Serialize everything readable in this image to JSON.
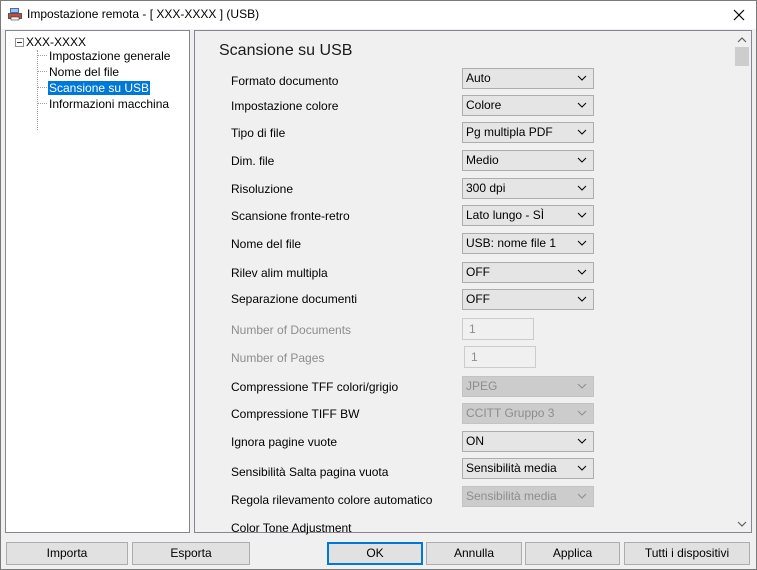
{
  "window": {
    "title": "Impostazione remota - [ XXX-XXXX  ] (USB)",
    "app_icon": "printer-app-icon",
    "close_icon": "close-icon"
  },
  "tree": {
    "root_label": "XXX-XXXX",
    "items": [
      {
        "label": "Impostazione generale",
        "selected": false
      },
      {
        "label": "Nome del file",
        "selected": false
      },
      {
        "label": "Scansione su USB",
        "selected": true
      },
      {
        "label": "Informazioni macchina",
        "selected": false
      }
    ]
  },
  "main": {
    "title": "Scansione su USB",
    "settings": [
      {
        "label": "Formato documento",
        "value": "Auto",
        "type": "combo",
        "disabled": false
      },
      {
        "label": "Impostazione colore",
        "value": "Colore",
        "type": "combo",
        "disabled": false
      },
      {
        "label": "Tipo di file",
        "value": "Pg multipla PDF",
        "type": "combo",
        "disabled": false
      },
      {
        "label": "Dim. file",
        "value": "Medio",
        "type": "combo",
        "disabled": false
      },
      {
        "label": "Risoluzione",
        "value": "300 dpi",
        "type": "combo",
        "disabled": false
      },
      {
        "label": "Scansione fronte-retro",
        "value": "Lato lungo - SÌ",
        "type": "combo",
        "disabled": false
      },
      {
        "label": "Nome del file",
        "value": "USB: nome file 1",
        "type": "combo",
        "disabled": false
      },
      {
        "label": "Rilev alim multipla",
        "value": "OFF",
        "type": "combo",
        "disabled": false
      },
      {
        "label": "Separazione documenti",
        "value": "OFF",
        "type": "combo",
        "disabled": false
      },
      {
        "label": "Number of Documents",
        "value": "1",
        "type": "number",
        "disabled": true
      },
      {
        "label": "Number of Pages",
        "value": "1",
        "type": "number",
        "disabled": true
      },
      {
        "label": "Compressione TFF colori/grigio",
        "value": "JPEG",
        "type": "combo",
        "disabled": true
      },
      {
        "label": "Compressione TIFF BW",
        "value": "CCITT Gruppo 3",
        "type": "combo",
        "disabled": true
      },
      {
        "label": "Ignora pagine vuote",
        "value": "ON",
        "type": "combo",
        "disabled": false
      },
      {
        "label": "Sensibilità Salta pagina vuota",
        "value": "Sensibilità media",
        "type": "combo",
        "disabled": false
      },
      {
        "label": "Regola rilevamento colore automatico",
        "value": "Sensibilità media",
        "type": "combo",
        "disabled": true
      },
      {
        "label": "Color Tone Adjustment",
        "value": "",
        "type": "label",
        "disabled": false
      }
    ]
  },
  "buttons": {
    "import": "Importa",
    "export": "Esporta",
    "ok": "OK",
    "cancel": "Annulla",
    "apply": "Applica",
    "all_devices": "Tutti i dispositivi"
  },
  "colors": {
    "selection": "#0078d7",
    "disabled_text": "#8d8d8d"
  }
}
